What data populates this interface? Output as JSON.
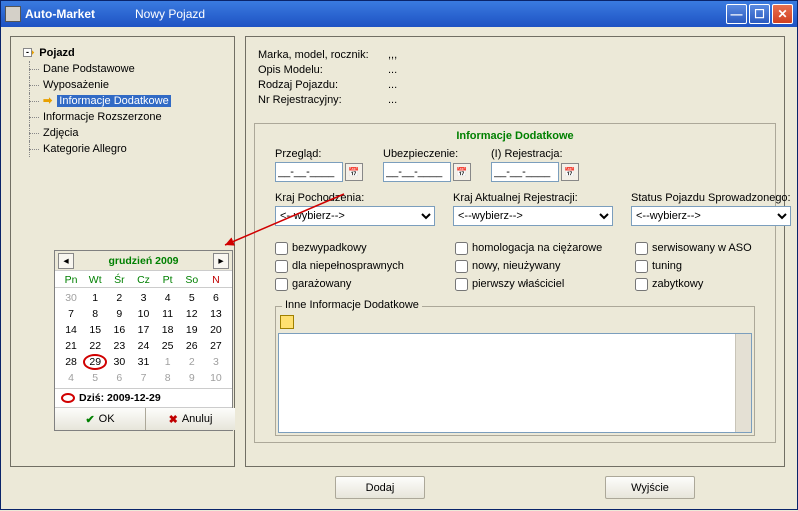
{
  "window": {
    "app": "Auto-Market",
    "subtitle": "Nowy Pojazd"
  },
  "tree": {
    "root": "Pojazd",
    "items": [
      "Dane Podstawowe",
      "Wyposażenie",
      "Informacje Dodatkowe",
      "Informacje Rozszerzone",
      "Zdjęcia",
      "Kategorie Allegro"
    ],
    "selected_index": 2
  },
  "summary": {
    "rows": [
      {
        "label": "Marka, model, rocznik:",
        "value": ",,,"
      },
      {
        "label": "Opis Modelu:",
        "value": "..."
      },
      {
        "label": "Rodzaj Pojazdu:",
        "value": "..."
      },
      {
        "label": "Nr Rejestracyjny:",
        "value": "..."
      }
    ]
  },
  "section_title": "Informacje Dodatkowe",
  "dates": {
    "przeglad": {
      "label": "Przegląd:",
      "value": "__-__-____"
    },
    "ubezp": {
      "label": "Ubezpieczenie:",
      "value": "__-__-____"
    },
    "rejes": {
      "label": "(I) Rejestracja:",
      "value": "__-__-____"
    }
  },
  "selects": {
    "kraj_pochodzenia": {
      "label": "Kraj Pochodzenia:",
      "value": "<--wybierz-->"
    },
    "kraj_rejestracji": {
      "label": "Kraj Aktualnej Rejestracji:",
      "value": "<--wybierz-->"
    },
    "status": {
      "label": "Status Pojazdu Sprowadzonego:",
      "value": "<--wybierz-->"
    }
  },
  "checks": [
    "bezwypadkowy",
    "homologacja na ciężarowe",
    "serwisowany w ASO",
    "dla niepełnosprawnych",
    "nowy, nieużywany",
    "tuning",
    "garażowany",
    "pierwszy właściciel",
    "zabytkowy"
  ],
  "info_box_title": "Inne Informacje Dodatkowe",
  "footer": {
    "add": "Dodaj",
    "exit": "Wyjście"
  },
  "calendar": {
    "title": "grudzień 2009",
    "dow": [
      "Pn",
      "Wt",
      "Śr",
      "Cz",
      "Pt",
      "So",
      "N"
    ],
    "today_label": "Dziś:",
    "today_date": "2009-12-29",
    "ok": "OK",
    "cancel": "Anuluj",
    "lead": [
      "30"
    ],
    "days": [
      "1",
      "2",
      "3",
      "4",
      "5",
      "6",
      "7",
      "8",
      "9",
      "10",
      "11",
      "12",
      "13",
      "14",
      "15",
      "16",
      "17",
      "18",
      "19",
      "20",
      "21",
      "22",
      "23",
      "24",
      "25",
      "26",
      "27",
      "28",
      "29",
      "30",
      "31"
    ],
    "trail": [
      "1",
      "2",
      "3",
      "4",
      "5",
      "6",
      "7",
      "8",
      "9",
      "10"
    ],
    "today_day": "29"
  },
  "dots": "..."
}
